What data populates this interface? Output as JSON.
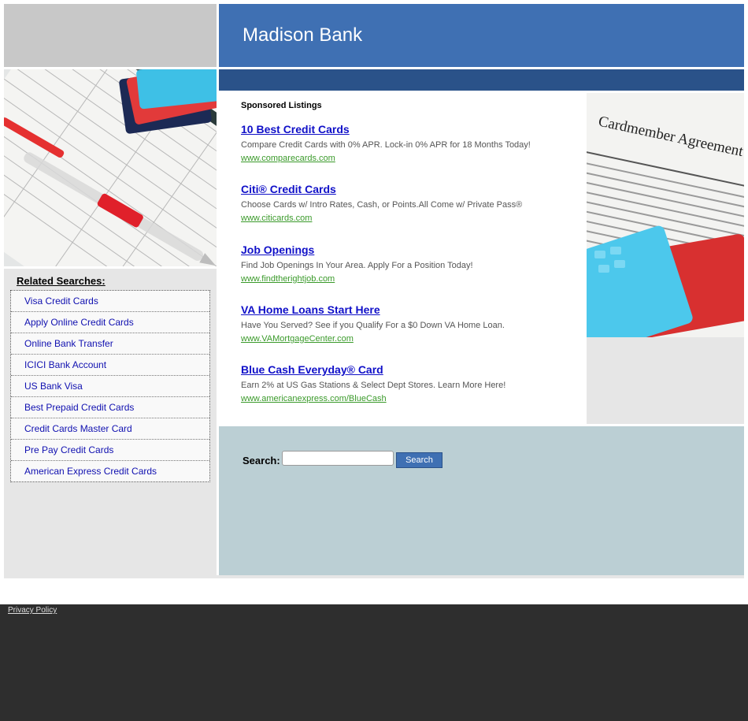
{
  "header": {
    "title": "Madison Bank"
  },
  "sidebar": {
    "related_title": "Related Searches:",
    "items": [
      {
        "label": "Visa Credit Cards"
      },
      {
        "label": "Apply Online Credit Cards"
      },
      {
        "label": "Online Bank Transfer"
      },
      {
        "label": "ICICI Bank Account"
      },
      {
        "label": "US Bank Visa"
      },
      {
        "label": "Best Prepaid Credit Cards"
      },
      {
        "label": "Credit Cards Master Card"
      },
      {
        "label": "Pre Pay Credit Cards"
      },
      {
        "label": "American Express Credit Cards"
      }
    ]
  },
  "main": {
    "sponsored_label": "Sponsored Listings",
    "listings": [
      {
        "title": "10 Best Credit Cards",
        "desc": "Compare Credit Cards with 0% APR. Lock-in 0% APR for 18 Months Today!",
        "url": "www.comparecards.com"
      },
      {
        "title": "Citi® Credit Cards",
        "desc": "Choose Cards w/ Intro Rates, Cash, or Points.All Come w/ Private Pass®",
        "url": "www.citicards.com"
      },
      {
        "title": "Job Openings",
        "desc": "Find Job Openings In Your Area. Apply For a Position Today!",
        "url": "www.findtherightjob.com"
      },
      {
        "title": "VA Home Loans Start Here",
        "desc": "Have You Served? See if you Qualify For a $0 Down VA Home Loan.",
        "url": "www.VAMortgageCenter.com"
      },
      {
        "title": "Blue Cash Everyday® Card",
        "desc": "Earn 2% at US Gas Stations & Select Dept Stores. Learn More Here!",
        "url": "www.americanexpress.com/BlueCash"
      }
    ]
  },
  "search": {
    "label": "Search:",
    "value": "",
    "button": "Search"
  },
  "footer": {
    "privacy": "Privacy Policy"
  },
  "images": {
    "right_heading": "Cardmember Agreement"
  },
  "colors": {
    "header": "#3f70b3",
    "header_bar": "#2a5289",
    "search_bg": "#bbcfd4",
    "footer": "#2e2e2e",
    "link": "#1010c8",
    "url": "#3a9a2a"
  }
}
